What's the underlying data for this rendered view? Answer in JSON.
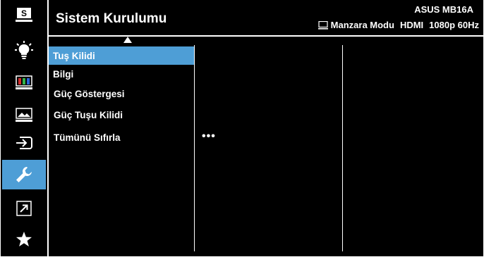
{
  "header": {
    "title": "Sistem Kurulumu",
    "model": "ASUS MB16A",
    "status": {
      "orientation_icon": "monitor-icon",
      "orientation": "Manzara Modu",
      "input": "HDMI",
      "resolution": "1080p 60Hz"
    }
  },
  "sidebar": {
    "items": [
      {
        "icon": "splendid-s-icon",
        "name": "Splendid"
      },
      {
        "icon": "bulb-icon",
        "name": "Blue Light Filter"
      },
      {
        "icon": "color-bars-icon",
        "name": "Color"
      },
      {
        "icon": "image-icon",
        "name": "Image"
      },
      {
        "icon": "input-select-icon",
        "name": "Input Select"
      },
      {
        "icon": "wrench-icon",
        "name": "System Setup",
        "active": true
      },
      {
        "icon": "shortcut-arrow-icon",
        "name": "Shortcut"
      },
      {
        "icon": "star-icon",
        "name": "MyFavorite"
      }
    ]
  },
  "menu": {
    "items": [
      {
        "label": "Tuş Kilidi",
        "active": true
      },
      {
        "label": "Bilgi"
      },
      {
        "label": "Güç Göstergesi"
      },
      {
        "label": "Güç Tuşu Kilidi"
      },
      {
        "label": "Tümünü Sıfırla"
      }
    ],
    "more": "•••"
  },
  "colors": {
    "background": "#000000",
    "accent": "#4e9ed6",
    "text": "#ffffff"
  }
}
